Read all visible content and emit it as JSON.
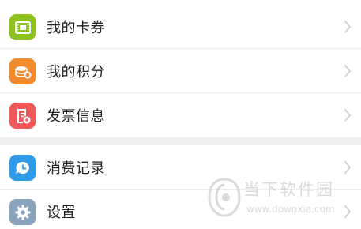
{
  "menu_group_1": [
    {
      "label": "我的卡券",
      "icon": "coupon-icon",
      "color": "#8dc21f"
    },
    {
      "label": "我的积分",
      "icon": "points-coins-icon",
      "color": "#f28a2e"
    },
    {
      "label": "发票信息",
      "icon": "invoice-icon",
      "color": "#f0595a"
    }
  ],
  "menu_group_2": [
    {
      "label": "消费记录",
      "icon": "consumption-record-icon",
      "color": "#2f9be8"
    },
    {
      "label": "设置",
      "icon": "settings-gear-icon",
      "color": "#8aa2bd"
    }
  ],
  "watermark": {
    "name": "当下软件园",
    "url": "www.downxia.com"
  },
  "colors": {
    "separator": "#eeeeee",
    "chevron": "#c7c7cc"
  }
}
